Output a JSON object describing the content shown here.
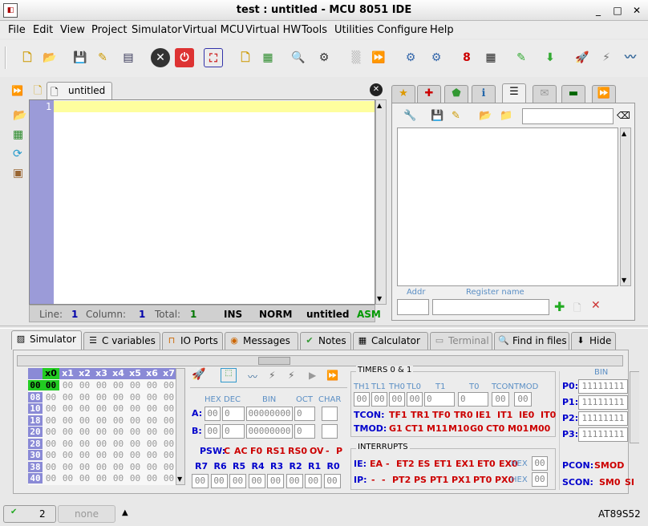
{
  "window": {
    "title": "test : untitled - MCU 8051 IDE"
  },
  "menu": [
    "File",
    "Edit",
    "View",
    "Project",
    "Simulator",
    "Virtual MCU",
    "Virtual HW",
    "Tools",
    "Utilities",
    "Configure",
    "Help"
  ],
  "editor": {
    "tab_label": "untitled",
    "line_number": "1",
    "status": {
      "line_label": "Line:",
      "line": "1",
      "col_label": "Column:",
      "col": "1",
      "total_label": "Total:",
      "total": "1",
      "ins": "INS",
      "norm": "NORM",
      "file": "untitled",
      "lang": "ASM"
    }
  },
  "right_panel": {
    "search_value": "",
    "addr_label": "Addr",
    "regname_label": "Register name",
    "addr_value": "",
    "regname_value": ""
  },
  "bottom_tabs": [
    "Simulator",
    "C variables",
    "IO Ports",
    "Messages",
    "Notes",
    "Calculator",
    "Terminal",
    "Find in files",
    "Hide"
  ],
  "memory": {
    "col_headers": [
      "x0",
      "x1",
      "x2",
      "x3",
      "x4",
      "x5",
      "x6",
      "x7"
    ],
    "row_headers": [
      "00",
      "08",
      "10",
      "18",
      "20",
      "28",
      "30",
      "38",
      "40"
    ],
    "cell": "00"
  },
  "regs": {
    "hdr": [
      "HEX",
      "DEC",
      "BIN",
      "OCT",
      "CHAR"
    ],
    "a": {
      "label": "A:",
      "hex": "00",
      "dec": "0",
      "bin": "00000000",
      "oct": "0"
    },
    "b": {
      "label": "B:",
      "hex": "00",
      "dec": "0",
      "bin": "00000000",
      "oct": "0"
    },
    "psw_label": "PSW:",
    "psw_bits": [
      "C",
      "AC",
      "F0",
      "RS1",
      "RS0",
      "OV",
      "-",
      "P"
    ],
    "rn_labels": [
      "R7",
      "R6",
      "R5",
      "R4",
      "R3",
      "R2",
      "R1",
      "R0"
    ],
    "rn_value": "00"
  },
  "timers": {
    "title": "TIMERS 0 & 1",
    "labels": [
      "TH1",
      "TL1",
      "TH0",
      "TL0",
      "T1",
      "T0",
      "TCON",
      "TMOD"
    ],
    "values": [
      "00",
      "00",
      "00",
      "00",
      "0",
      "0",
      "00",
      "00"
    ],
    "tcon_label": "TCON:",
    "tcon_bits": [
      "TF1",
      "TR1",
      "TF0",
      "TR0",
      "IE1",
      "IT1",
      "IE0",
      "IT0"
    ],
    "tmod_label": "TMOD:",
    "tmod_bits": [
      "G1",
      "CT1",
      "M11",
      "M10",
      "G0",
      "CT0",
      "M01",
      "M00"
    ]
  },
  "interrupts": {
    "title": "INTERRUPTS",
    "ie_label": "IE:",
    "ie_bits": [
      "EA",
      "-",
      "ET2",
      "ES",
      "ET1",
      "EX1",
      "ET0",
      "EX0"
    ],
    "ip_label": "IP:",
    "ip_bits": [
      "-",
      "-",
      "PT2",
      "PS",
      "PT1",
      "PX1",
      "PT0",
      "PX0"
    ],
    "hex_label": "HEX",
    "ie_hex": "00",
    "ip_hex": "00"
  },
  "ports": {
    "bin_label": "BIN",
    "labels": [
      "P0:",
      "P1:",
      "P2:",
      "P3:"
    ],
    "values": [
      "11111111",
      "11111111",
      "11111111",
      "11111111"
    ],
    "pcon_label": "PCON:",
    "pcon_bit": "SMOD",
    "scon_label": "SCON:",
    "scon_bits": [
      "SM0",
      "SI"
    ]
  },
  "statusbar": {
    "count": "2",
    "none_label": "none",
    "device": "AT89S52"
  }
}
